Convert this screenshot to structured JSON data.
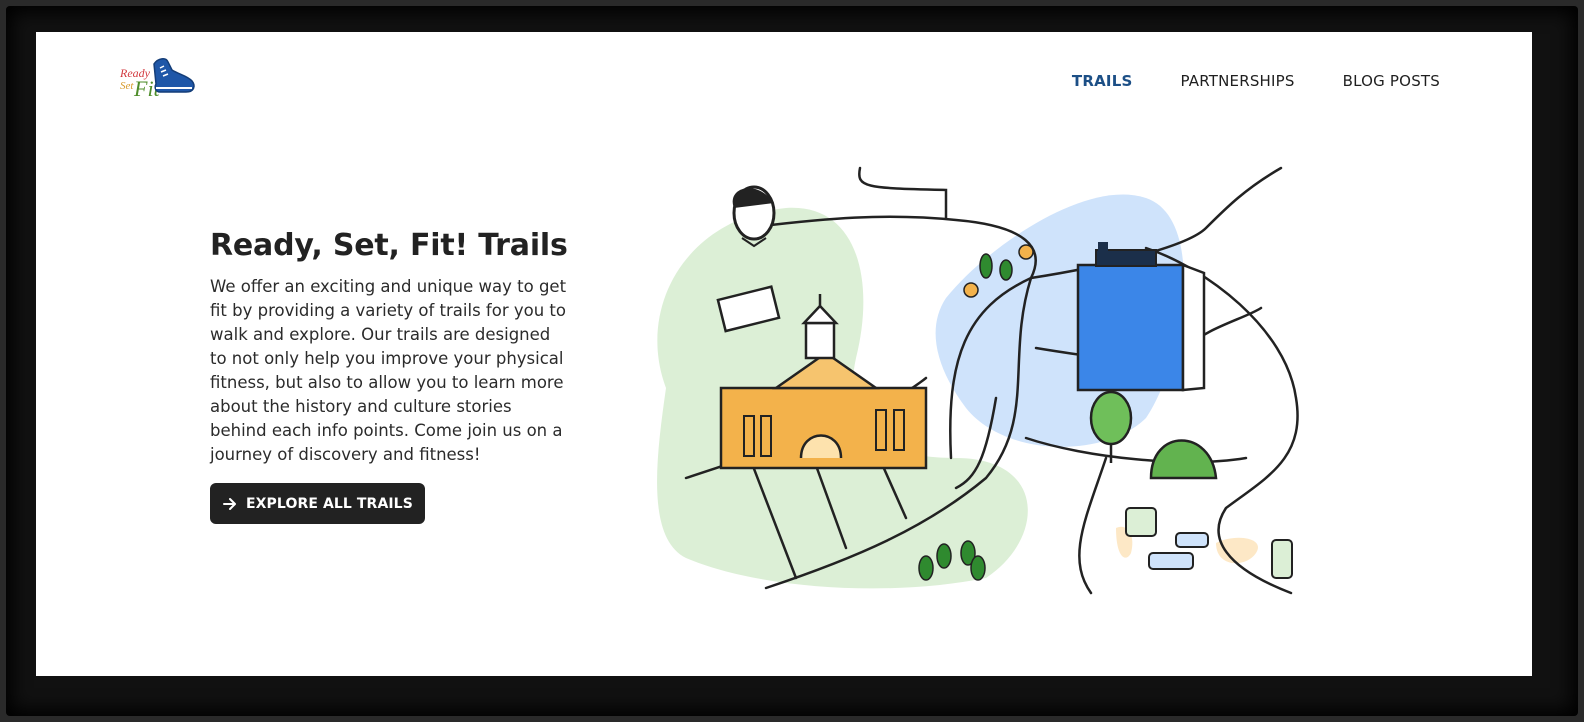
{
  "brand": {
    "logo_ready": "Ready",
    "logo_set": "Set",
    "logo_fit": "Fit"
  },
  "nav": {
    "items": [
      {
        "label": "TRAILS",
        "active": true
      },
      {
        "label": "PARTNERSHIPS",
        "active": false
      },
      {
        "label": "BLOG POSTS",
        "active": false
      }
    ]
  },
  "hero": {
    "title": "Ready, Set, Fit! Trails",
    "description": "We offer an exciting and unique way to get fit by providing a variety of trails for you to walk and explore. Our trails are designed to not only help you improve your physical fitness, but also to allow you to learn more about the history and culture stories behind each info points. Come join us on a journey of discovery and fitness!",
    "cta_label": "EXPLORE ALL TRAILS",
    "cta_icon": "arrow-right-icon"
  },
  "colors": {
    "accent": "#1c4f86",
    "button_bg": "#222222",
    "green_area": "#dcefd6",
    "blue_area": "#cfe3fb",
    "building_blue": "#3b86e8",
    "building_orange": "#f3b24b"
  }
}
